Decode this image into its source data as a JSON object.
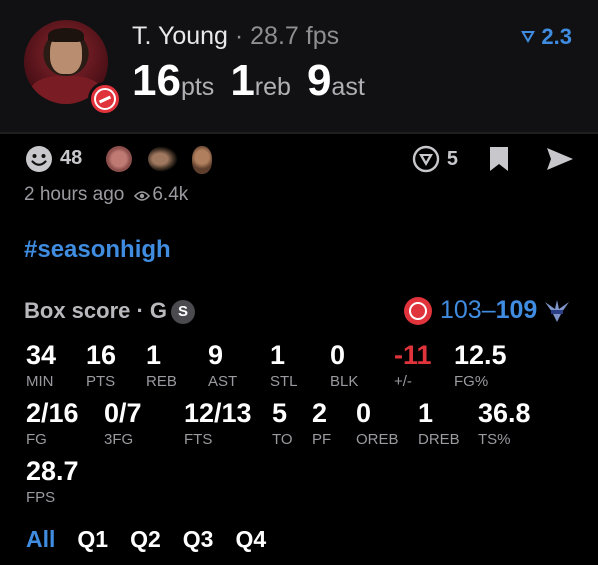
{
  "player": {
    "name": "T. Young",
    "separator": " · ",
    "fps_label": "28.7 fps",
    "pts": "16",
    "pts_unit": "pts",
    "reb": "1",
    "reb_unit": "reb",
    "ast": "9",
    "ast_unit": "ast",
    "rating": "2.3"
  },
  "actions": {
    "reaction_count": "48",
    "vote_count": "5",
    "posted": "2 hours ago",
    "views": "6.4k"
  },
  "post": {
    "hashtag": "#seasonhigh"
  },
  "box_score": {
    "title": "Box score · G",
    "position_badge": "S",
    "score_home": "103",
    "score_dash": "–",
    "score_away": "109",
    "row1": [
      {
        "value": "34",
        "label": "MIN"
      },
      {
        "value": "16",
        "label": "PTS"
      },
      {
        "value": "1",
        "label": "REB"
      },
      {
        "value": "9",
        "label": "AST"
      },
      {
        "value": "1",
        "label": "STL"
      },
      {
        "value": "0",
        "label": "BLK"
      },
      {
        "value": "-11",
        "label": "+/-"
      },
      {
        "value": "12.5",
        "label": "FG%"
      }
    ],
    "row2": [
      {
        "value": "2/16",
        "label": "FG"
      },
      {
        "value": "0/7",
        "label": "3FG"
      },
      {
        "value": "12/13",
        "label": "FTS"
      },
      {
        "value": "5",
        "label": "TO"
      },
      {
        "value": "2",
        "label": "PF"
      },
      {
        "value": "0",
        "label": "OREB"
      },
      {
        "value": "1",
        "label": "DREB"
      },
      {
        "value": "36.8",
        "label": "TS%"
      }
    ],
    "row3": [
      {
        "value": "28.7",
        "label": "FPS"
      }
    ]
  },
  "quarters": [
    "All",
    "Q1",
    "Q2",
    "Q3",
    "Q4"
  ],
  "colors": {
    "accent": "#3f8ce0",
    "negative": "#e0333c",
    "team_home": "#e0333c",
    "team_away": "#7f95c9"
  },
  "icons": [
    "smiley-icon",
    "vpt-icon",
    "bookmark-icon",
    "send-icon",
    "eye-icon",
    "rating-chevron-icon"
  ]
}
